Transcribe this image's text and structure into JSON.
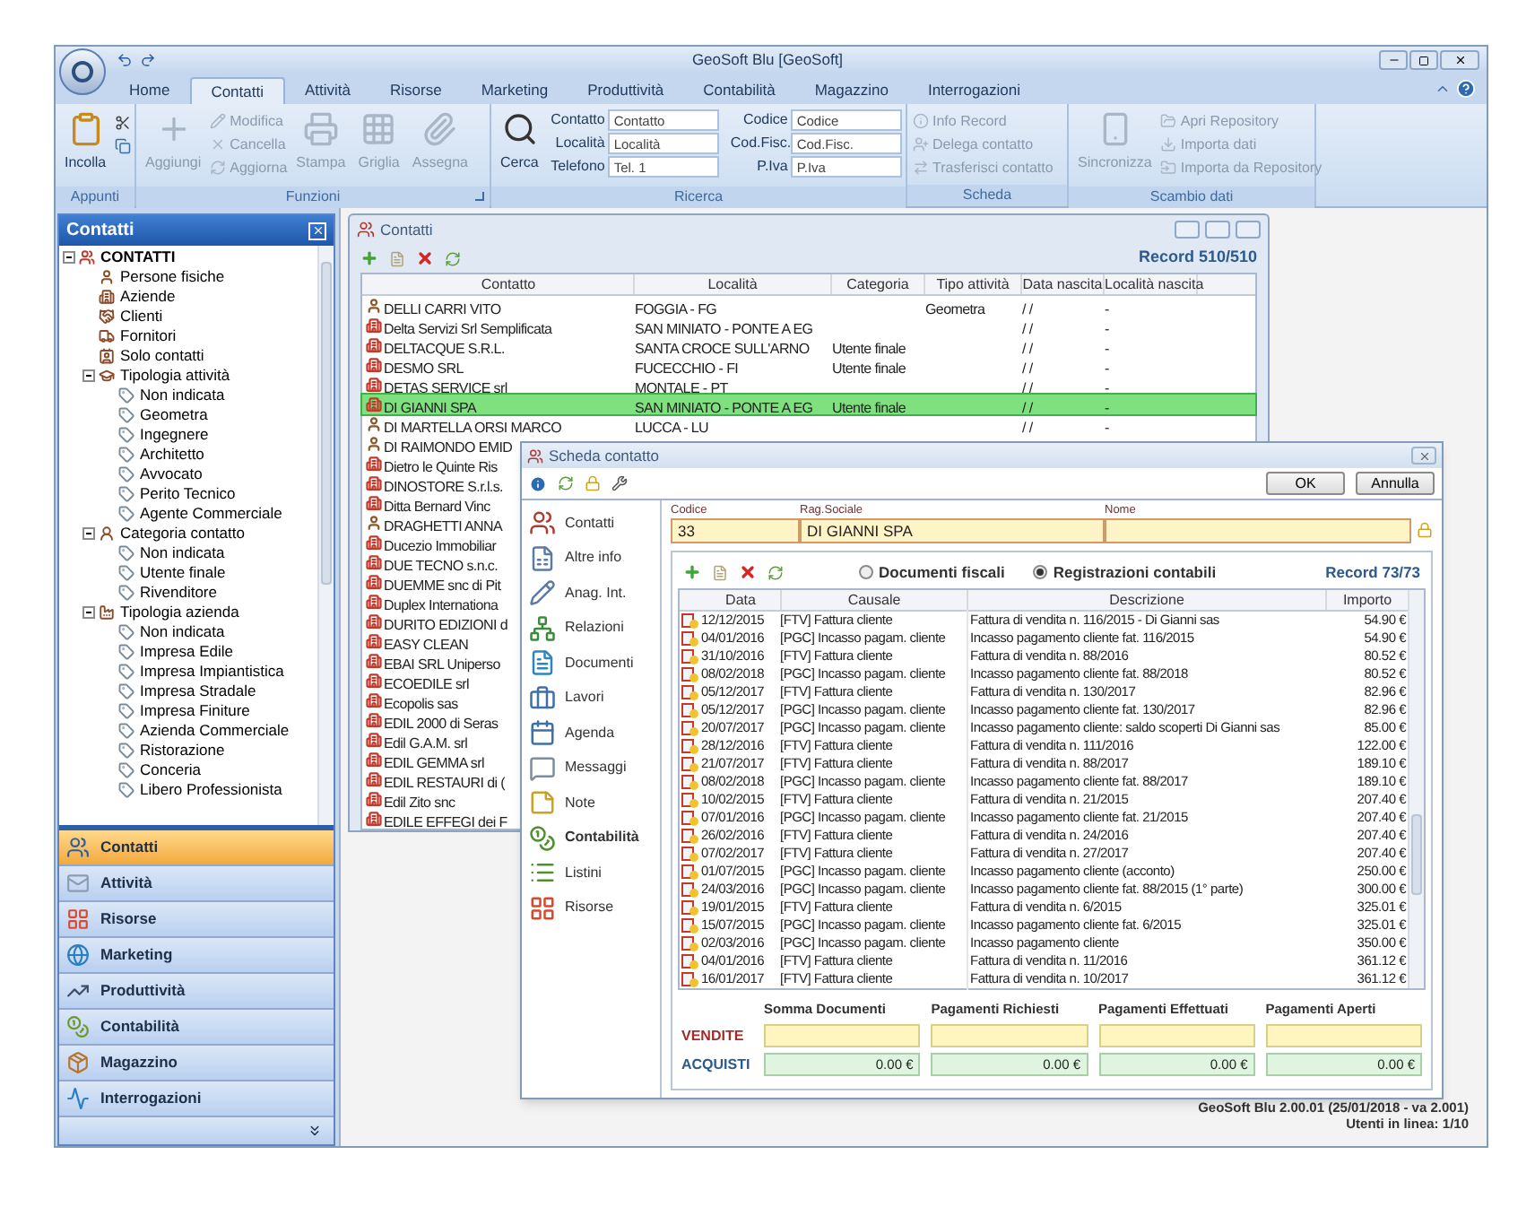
{
  "window": {
    "title": "GeoSoft Blu [GeoSoft]"
  },
  "ribbon": {
    "tabs": [
      {
        "label": "Home",
        "selected": false
      },
      {
        "label": "Contatti",
        "selected": true
      },
      {
        "label": "Attività",
        "selected": false
      },
      {
        "label": "Risorse",
        "selected": false
      },
      {
        "label": "Marketing",
        "selected": false
      },
      {
        "label": "Produttività",
        "selected": false
      },
      {
        "label": "Contabilità",
        "selected": false
      },
      {
        "label": "Magazzino",
        "selected": false
      },
      {
        "label": "Interrogazioni",
        "selected": false
      }
    ],
    "groups": [
      {
        "title": "Appunti",
        "buttons": [
          {
            "label": "Incolla",
            "disabled": false
          }
        ]
      },
      {
        "title": "Funzioni",
        "buttons": [
          {
            "label": "Aggiungi",
            "disabled": true
          },
          {
            "label": "Modifica",
            "disabled": true
          },
          {
            "label": "Cancella",
            "disabled": true
          },
          {
            "label": "Aggiorna",
            "disabled": true
          },
          {
            "label": "Stampa",
            "disabled": true
          },
          {
            "label": "Griglia",
            "disabled": true
          },
          {
            "label": "Assegna",
            "disabled": true
          }
        ]
      },
      {
        "title": "Ricerca",
        "buttons": [
          {
            "label": "Cerca",
            "disabled": false
          }
        ],
        "fields": [
          {
            "label": "Contatto",
            "placeholder": "Contatto"
          },
          {
            "label": "Località",
            "placeholder": "Località"
          },
          {
            "label": "Telefono",
            "placeholder": "Tel. 1"
          },
          {
            "label": "Codice",
            "placeholder": "Codice"
          },
          {
            "label": "Cod.Fisc.",
            "placeholder": "Cod.Fisc."
          },
          {
            "label": "P.Iva",
            "placeholder": "P.Iva"
          }
        ]
      },
      {
        "title": "Scheda",
        "buttons": [
          {
            "label": "Info Record",
            "disabled": true
          },
          {
            "label": "Delega contatto",
            "disabled": true
          },
          {
            "label": "Trasferisci contatto",
            "disabled": true
          }
        ]
      },
      {
        "title": "Scambio dati",
        "buttons": [
          {
            "label": "Sincronizza",
            "disabled": true
          },
          {
            "label": "Apri Repository",
            "disabled": true
          },
          {
            "label": "Importa dati",
            "disabled": true
          },
          {
            "label": "Importa da Repository",
            "disabled": true
          }
        ]
      }
    ]
  },
  "sidebar": {
    "title": "Contatti",
    "tree": [
      {
        "label": "CONTATTI",
        "expanded": true,
        "children": [
          {
            "label": "Persone fisiche"
          },
          {
            "label": "Aziende"
          },
          {
            "label": "Clienti"
          },
          {
            "label": "Fornitori"
          },
          {
            "label": "Solo contatti"
          },
          {
            "label": "Tipologia attività",
            "expanded": true,
            "children": [
              {
                "label": "Non indicata"
              },
              {
                "label": "Geometra"
              },
              {
                "label": "Ingegnere"
              },
              {
                "label": "Architetto"
              },
              {
                "label": "Avvocato"
              },
              {
                "label": "Perito Tecnico"
              },
              {
                "label": "Agente Commerciale"
              }
            ]
          },
          {
            "label": "Categoria contatto",
            "expanded": true,
            "children": [
              {
                "label": "Non indicata"
              },
              {
                "label": "Utente finale"
              },
              {
                "label": "Rivenditore"
              }
            ]
          },
          {
            "label": "Tipologia azienda",
            "expanded": true,
            "children": [
              {
                "label": "Non indicata"
              },
              {
                "label": "Impresa Edile"
              },
              {
                "label": "Impresa Impiantistica"
              },
              {
                "label": "Impresa Stradale"
              },
              {
                "label": "Impresa Finiture"
              },
              {
                "label": "Azienda Commerciale"
              },
              {
                "label": "Ristorazione"
              },
              {
                "label": "Conceria"
              },
              {
                "label": "Libero Professionista"
              }
            ]
          }
        ]
      }
    ],
    "nav": [
      {
        "label": "Contatti",
        "selected": true
      },
      {
        "label": "Attività",
        "selected": false
      },
      {
        "label": "Risorse",
        "selected": false
      },
      {
        "label": "Marketing",
        "selected": false
      },
      {
        "label": "Produttività",
        "selected": false
      },
      {
        "label": "Contabilità",
        "selected": false
      },
      {
        "label": "Magazzino",
        "selected": false
      },
      {
        "label": "Interrogazioni",
        "selected": false
      }
    ]
  },
  "contacts_window": {
    "title": "Contatti",
    "record": "Record 510/510",
    "columns": [
      "Contatto",
      "Località",
      "Categoria",
      "Tipo attività",
      "Data nascita",
      "Località nascita"
    ],
    "rows": [
      {
        "kind": "person",
        "selected": false,
        "contatto": "DELLI CARRI VITO",
        "localita": "FOGGIA - FG",
        "tipo_attivita": "Geometra",
        "data_nascita": "/ /",
        "localita_nascita": "-"
      },
      {
        "kind": "company",
        "selected": false,
        "contatto": "Delta Servizi Srl Semplificata",
        "localita": "SAN MINIATO - PONTE A EG",
        "data_nascita": "/ /",
        "localita_nascita": "-"
      },
      {
        "kind": "company",
        "selected": false,
        "contatto": "DELTACQUE S.R.L.",
        "localita": "SANTA CROCE SULL'ARNO",
        "categoria": "Utente finale",
        "data_nascita": "/ /",
        "localita_nascita": "-"
      },
      {
        "kind": "company",
        "selected": false,
        "contatto": "DESMO SRL",
        "localita": "FUCECCHIO - FI",
        "categoria": "Utente finale",
        "data_nascita": "/ /",
        "localita_nascita": "-"
      },
      {
        "kind": "company",
        "selected": false,
        "contatto": "DETAS SERVICE srl",
        "localita": "MONTALE - PT",
        "data_nascita": "/ /",
        "localita_nascita": "-"
      },
      {
        "kind": "company",
        "selected": true,
        "contatto": "DI GIANNI SPA",
        "localita": "SAN MINIATO - PONTE A EG",
        "categoria": "Utente finale",
        "data_nascita": "/ /",
        "localita_nascita": "-"
      },
      {
        "kind": "person",
        "selected": false,
        "contatto": "DI MARTELLA ORSI MARCO",
        "localita": "LUCCA - LU",
        "data_nascita": "/ /",
        "localita_nascita": "-"
      },
      {
        "kind": "person",
        "selected": false,
        "contatto": "DI RAIMONDO EMID"
      },
      {
        "kind": "company",
        "selected": false,
        "contatto": "Dietro le Quinte Ris"
      },
      {
        "kind": "company",
        "selected": false,
        "contatto": "DINOSTORE S.r.l.s."
      },
      {
        "kind": "company",
        "selected": false,
        "contatto": "Ditta Bernard Vinc"
      },
      {
        "kind": "person",
        "selected": false,
        "contatto": "DRAGHETTI ANNA"
      },
      {
        "kind": "company",
        "selected": false,
        "contatto": "Ducezio Immobiliar"
      },
      {
        "kind": "company",
        "selected": false,
        "contatto": "DUE TECNO s.n.c."
      },
      {
        "kind": "company",
        "selected": false,
        "contatto": "DUEMME snc di Pit"
      },
      {
        "kind": "company",
        "selected": false,
        "contatto": "Duplex Internationa"
      },
      {
        "kind": "company",
        "selected": false,
        "contatto": "DURITO EDIZIONI d"
      },
      {
        "kind": "company",
        "selected": false,
        "contatto": "EASY CLEAN"
      },
      {
        "kind": "company",
        "selected": false,
        "contatto": "EBAI SRL Uniperso"
      },
      {
        "kind": "company",
        "selected": false,
        "contatto": "ECOEDILE srl"
      },
      {
        "kind": "company",
        "selected": false,
        "contatto": "Ecopolis sas"
      },
      {
        "kind": "company",
        "selected": false,
        "contatto": "EDIL 2000 di Seras"
      },
      {
        "kind": "company",
        "selected": false,
        "contatto": "Edil G.A.M. srl"
      },
      {
        "kind": "company",
        "selected": false,
        "contatto": "EDIL GEMMA srl"
      },
      {
        "kind": "company",
        "selected": false,
        "contatto": "EDIL RESTAURI di ("
      },
      {
        "kind": "company",
        "selected": false,
        "contatto": "Edil Zito snc"
      },
      {
        "kind": "company",
        "selected": false,
        "contatto": "EDILE EFFEGI dei F"
      }
    ]
  },
  "contact_card": {
    "title": "Scheda contatto",
    "buttons": [
      "OK",
      "Annulla"
    ],
    "nav": [
      {
        "label": "Contatti",
        "selected": false
      },
      {
        "label": "Altre info",
        "selected": false
      },
      {
        "label": "Anag. Int.",
        "selected": false
      },
      {
        "label": "Relazioni",
        "selected": false
      },
      {
        "label": "Documenti",
        "selected": false
      },
      {
        "label": "Lavori",
        "selected": false
      },
      {
        "label": "Agenda",
        "selected": false
      },
      {
        "label": "Messaggi",
        "selected": false
      },
      {
        "label": "Note",
        "selected": false
      },
      {
        "label": "Contabilità",
        "selected": true
      },
      {
        "label": "Listini",
        "selected": false
      },
      {
        "label": "Risorse",
        "selected": false
      }
    ],
    "fields": [
      {
        "label": "Codice",
        "value": "33"
      },
      {
        "label": "Rag.Sociale",
        "value": "DI GIANNI SPA"
      },
      {
        "label": "Nome"
      }
    ],
    "view_options": [
      {
        "label": "Documenti fiscali",
        "selected": false
      },
      {
        "label": "Registrazioni contabili",
        "selected": true
      }
    ],
    "record": "Record 73/73",
    "columns": [
      "Data",
      "Causale",
      "Descrizione",
      "Importo"
    ],
    "rows": [
      {
        "data": "12/12/2015",
        "causale": "[FTV] Fattura cliente",
        "descrizione": "Fattura di vendita n. 116/2015 - Di Gianni sas",
        "importo": "54.90 €"
      },
      {
        "data": "04/01/2016",
        "causale": "[PGC] Incasso pagam. cliente",
        "descrizione": "Incasso pagamento cliente fat. 116/2015",
        "importo": "54.90 €"
      },
      {
        "data": "31/10/2016",
        "causale": "[FTV] Fattura cliente",
        "descrizione": "Fattura di vendita n. 88/2016",
        "importo": "80.52 €"
      },
      {
        "data": "08/02/2018",
        "causale": "[PGC] Incasso pagam. cliente",
        "descrizione": "Incasso pagamento cliente fat. 88/2018",
        "importo": "80.52 €"
      },
      {
        "data": "05/12/2017",
        "causale": "[FTV] Fattura cliente",
        "descrizione": "Fattura di vendita n. 130/2017",
        "importo": "82.96 €"
      },
      {
        "data": "05/12/2017",
        "causale": "[PGC] Incasso pagam. cliente",
        "descrizione": "Incasso pagamento cliente fat. 130/2017",
        "importo": "82.96 €"
      },
      {
        "data": "20/07/2017",
        "causale": "[PGC] Incasso pagam. cliente",
        "descrizione": "Incasso pagamento cliente: saldo scoperti Di Gianni sas",
        "importo": "85.00 €"
      },
      {
        "data": "28/12/2016",
        "causale": "[FTV] Fattura cliente",
        "descrizione": "Fattura di vendita n. 111/2016",
        "importo": "122.00 €"
      },
      {
        "data": "21/07/2017",
        "causale": "[FTV] Fattura cliente",
        "descrizione": "Fattura di vendita n. 88/2017",
        "importo": "189.10 €"
      },
      {
        "data": "08/02/2018",
        "causale": "[PGC] Incasso pagam. cliente",
        "descrizione": "Incasso pagamento cliente fat. 88/2017",
        "importo": "189.10 €"
      },
      {
        "data": "10/02/2015",
        "causale": "[FTV] Fattura cliente",
        "descrizione": "Fattura di vendita n. 21/2015",
        "importo": "207.40 €"
      },
      {
        "data": "07/01/2016",
        "causale": "[PGC] Incasso pagam. cliente",
        "descrizione": "Incasso pagamento cliente fat. 21/2015",
        "importo": "207.40 €"
      },
      {
        "data": "26/02/2016",
        "causale": "[FTV] Fattura cliente",
        "descrizione": "Fattura di vendita n. 24/2016",
        "importo": "207.40 €"
      },
      {
        "data": "07/02/2017",
        "causale": "[FTV] Fattura cliente",
        "descrizione": "Fattura di vendita n. 27/2017",
        "importo": "207.40 €"
      },
      {
        "data": "01/07/2015",
        "causale": "[PGC] Incasso pagam. cliente",
        "descrizione": "Incasso pagamento cliente (acconto)",
        "importo": "250.00 €"
      },
      {
        "data": "24/03/2016",
        "causale": "[PGC] Incasso pagam. cliente",
        "descrizione": "Incasso pagamento cliente fat. 88/2015 (1° parte)",
        "importo": "300.00 €"
      },
      {
        "data": "19/01/2015",
        "causale": "[FTV] Fattura cliente",
        "descrizione": "Fattura di vendita n. 6/2015",
        "importo": "325.01 €"
      },
      {
        "data": "15/07/2015",
        "causale": "[PGC] Incasso pagam. cliente",
        "descrizione": "Incasso pagamento cliente fat. 6/2015",
        "importo": "325.01 €"
      },
      {
        "data": "02/03/2016",
        "causale": "[PGC] Incasso pagam. cliente",
        "descrizione": "Incasso pagamento cliente",
        "importo": "350.00 €"
      },
      {
        "data": "04/01/2016",
        "causale": "[FTV] Fattura cliente",
        "descrizione": "Fattura di vendita n. 11/2016",
        "importo": "361.12 €"
      },
      {
        "data": "16/01/2017",
        "causale": "[FTV] Fattura cliente",
        "descrizione": "Fattura di vendita n. 10/2017",
        "importo": "361.12 €"
      }
    ],
    "summary": {
      "columns": [
        "Somma Documenti",
        "Pagamenti Richiesti",
        "Pagamenti Effettuati",
        "Pagamenti Aperti"
      ],
      "rows": [
        {
          "label": "VENDITE",
          "kind": "sales"
        },
        {
          "label": "ACQUISTI",
          "kind": "purchases",
          "values": [
            "0.00 €",
            "0.00 €",
            "0.00 €",
            "0.00 €"
          ]
        }
      ]
    }
  },
  "status": {
    "lines": [
      "GeoSoft Blu 2.00.01 (25/01/2018 - va 2.001)",
      "Utenti in linea: 1/10"
    ]
  }
}
